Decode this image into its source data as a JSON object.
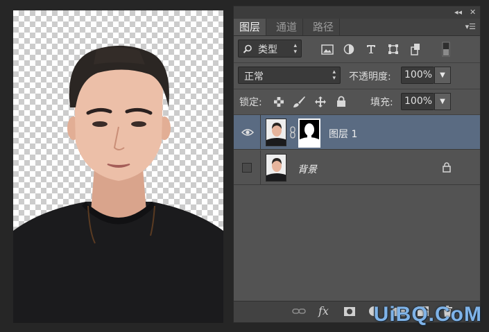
{
  "panel": {
    "tabs": [
      {
        "label": "图层",
        "active": true
      },
      {
        "label": "通道",
        "active": false
      },
      {
        "label": "路径",
        "active": false
      }
    ],
    "collapse_label": "◂◂",
    "close_label": "✕",
    "menu_label": "▾☰"
  },
  "filter": {
    "kind_label": "类型",
    "icons": [
      "image-filter-icon",
      "adjustment-filter-icon",
      "type-filter-icon",
      "shape-filter-icon",
      "smart-object-filter-icon",
      "filter-toggle-icon"
    ]
  },
  "blend": {
    "mode": "正常",
    "opacity_label": "不透明度:",
    "opacity_value": "100%"
  },
  "lock": {
    "label": "锁定:",
    "icons": [
      "lock-transparent-icon",
      "lock-image-icon",
      "lock-position-icon",
      "lock-all-icon"
    ],
    "fill_label": "填充:",
    "fill_value": "100%"
  },
  "layers": [
    {
      "name": "图层 1",
      "visible": true,
      "selected": true,
      "has_mask": true,
      "locked": false
    },
    {
      "name": "背景",
      "visible": false,
      "selected": false,
      "has_mask": false,
      "locked": true
    }
  ],
  "bottom_toolbar": {
    "fx_label": "fx",
    "icons": [
      "link-layers-icon",
      "fx-icon",
      "add-mask-icon",
      "adjustment-layer-icon",
      "new-group-icon",
      "new-layer-icon",
      "delete-layer-icon"
    ]
  },
  "watermark": "UiBQ.CoM",
  "colors": {
    "panel_bg": "#535353",
    "selected_layer": "#5a6b82",
    "watermark": "#7fb3e8"
  }
}
